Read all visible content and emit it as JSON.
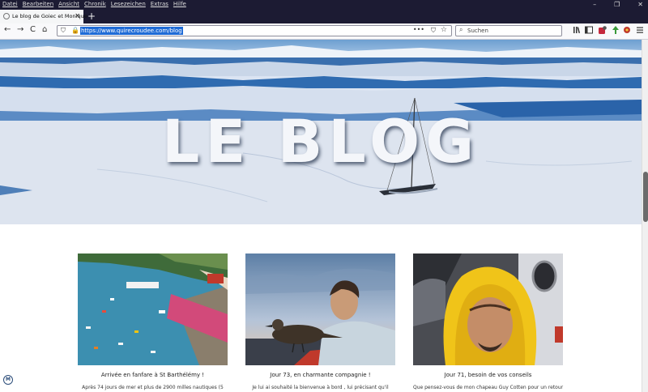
{
  "menubar": {
    "items": [
      "Datei",
      "Bearbeiten",
      "Ansicht",
      "Chronik",
      "Lesezeichen",
      "Extras",
      "Hilfe"
    ],
    "controls": [
      "–",
      "❐",
      "✕"
    ]
  },
  "tab": {
    "title": "Le blog de Goiec et Monique",
    "close": "✕"
  },
  "newtab": "+",
  "nav": {
    "back": "←",
    "forward": "→",
    "reload": "C",
    "home": "⌂"
  },
  "url": {
    "value": "https://www.quirecroudee.com/blog",
    "shield": "⛉",
    "lock": "🔒",
    "more": "•••",
    "pocket": "⛉",
    "star": "☆"
  },
  "search": {
    "placeholder": "Suchen",
    "icon": "⌕"
  },
  "toolbar_icons": [
    "library-icon",
    "sidebar-icon",
    "addon-badge-icon",
    "extension-green-icon",
    "extension-red-icon",
    "menu-icon"
  ],
  "hero": {
    "title": "LE BLOG"
  },
  "posts": [
    {
      "title": "Arrivée en fanfare à St Barthélémy !",
      "excerpt": "Après 74 jours de mer et plus de 2900 milles nautiques (5"
    },
    {
      "title": "Jour 73, en charmante compagnie !",
      "excerpt": "Je lui ai souhaité la bienvenue à bord , lui précisant qu'il"
    },
    {
      "title": "Jour 71, besoin de vos conseils",
      "excerpt": "Que pensez-vous de mon chapeau Guy Cotten pour un retour"
    }
  ],
  "badge": "M",
  "colors": {
    "chrome_dark": "#1c1b33",
    "url_highlight": "#1f6bd6",
    "ice": "#dfe6f0",
    "sea": "#2f6bb0"
  }
}
